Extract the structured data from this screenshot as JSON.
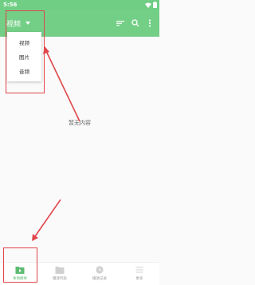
{
  "status_bar": {
    "time": "5:56"
  },
  "toolbar": {
    "category": "视频",
    "icons": [
      "sort-icon",
      "search-icon",
      "more-vert-icon"
    ]
  },
  "dropdown": {
    "items": [
      {
        "label": "视频"
      },
      {
        "label": "图片"
      },
      {
        "label": "音频"
      }
    ]
  },
  "main": {
    "empty_message": "暂无内容"
  },
  "bottom_nav": {
    "items": [
      {
        "label": "本地媒体",
        "icon": "play-folder-icon",
        "active": true
      },
      {
        "label": "播放列表",
        "icon": "folder-icon",
        "active": false
      },
      {
        "label": "播放记录",
        "icon": "history-icon",
        "active": false
      },
      {
        "label": "更多",
        "icon": "menu-icon",
        "active": false
      }
    ]
  },
  "colors": {
    "primary": "#73cf86",
    "status_bar": "#6fce84",
    "active_nav": "#5dbb72",
    "annotation": "#e0464a"
  }
}
